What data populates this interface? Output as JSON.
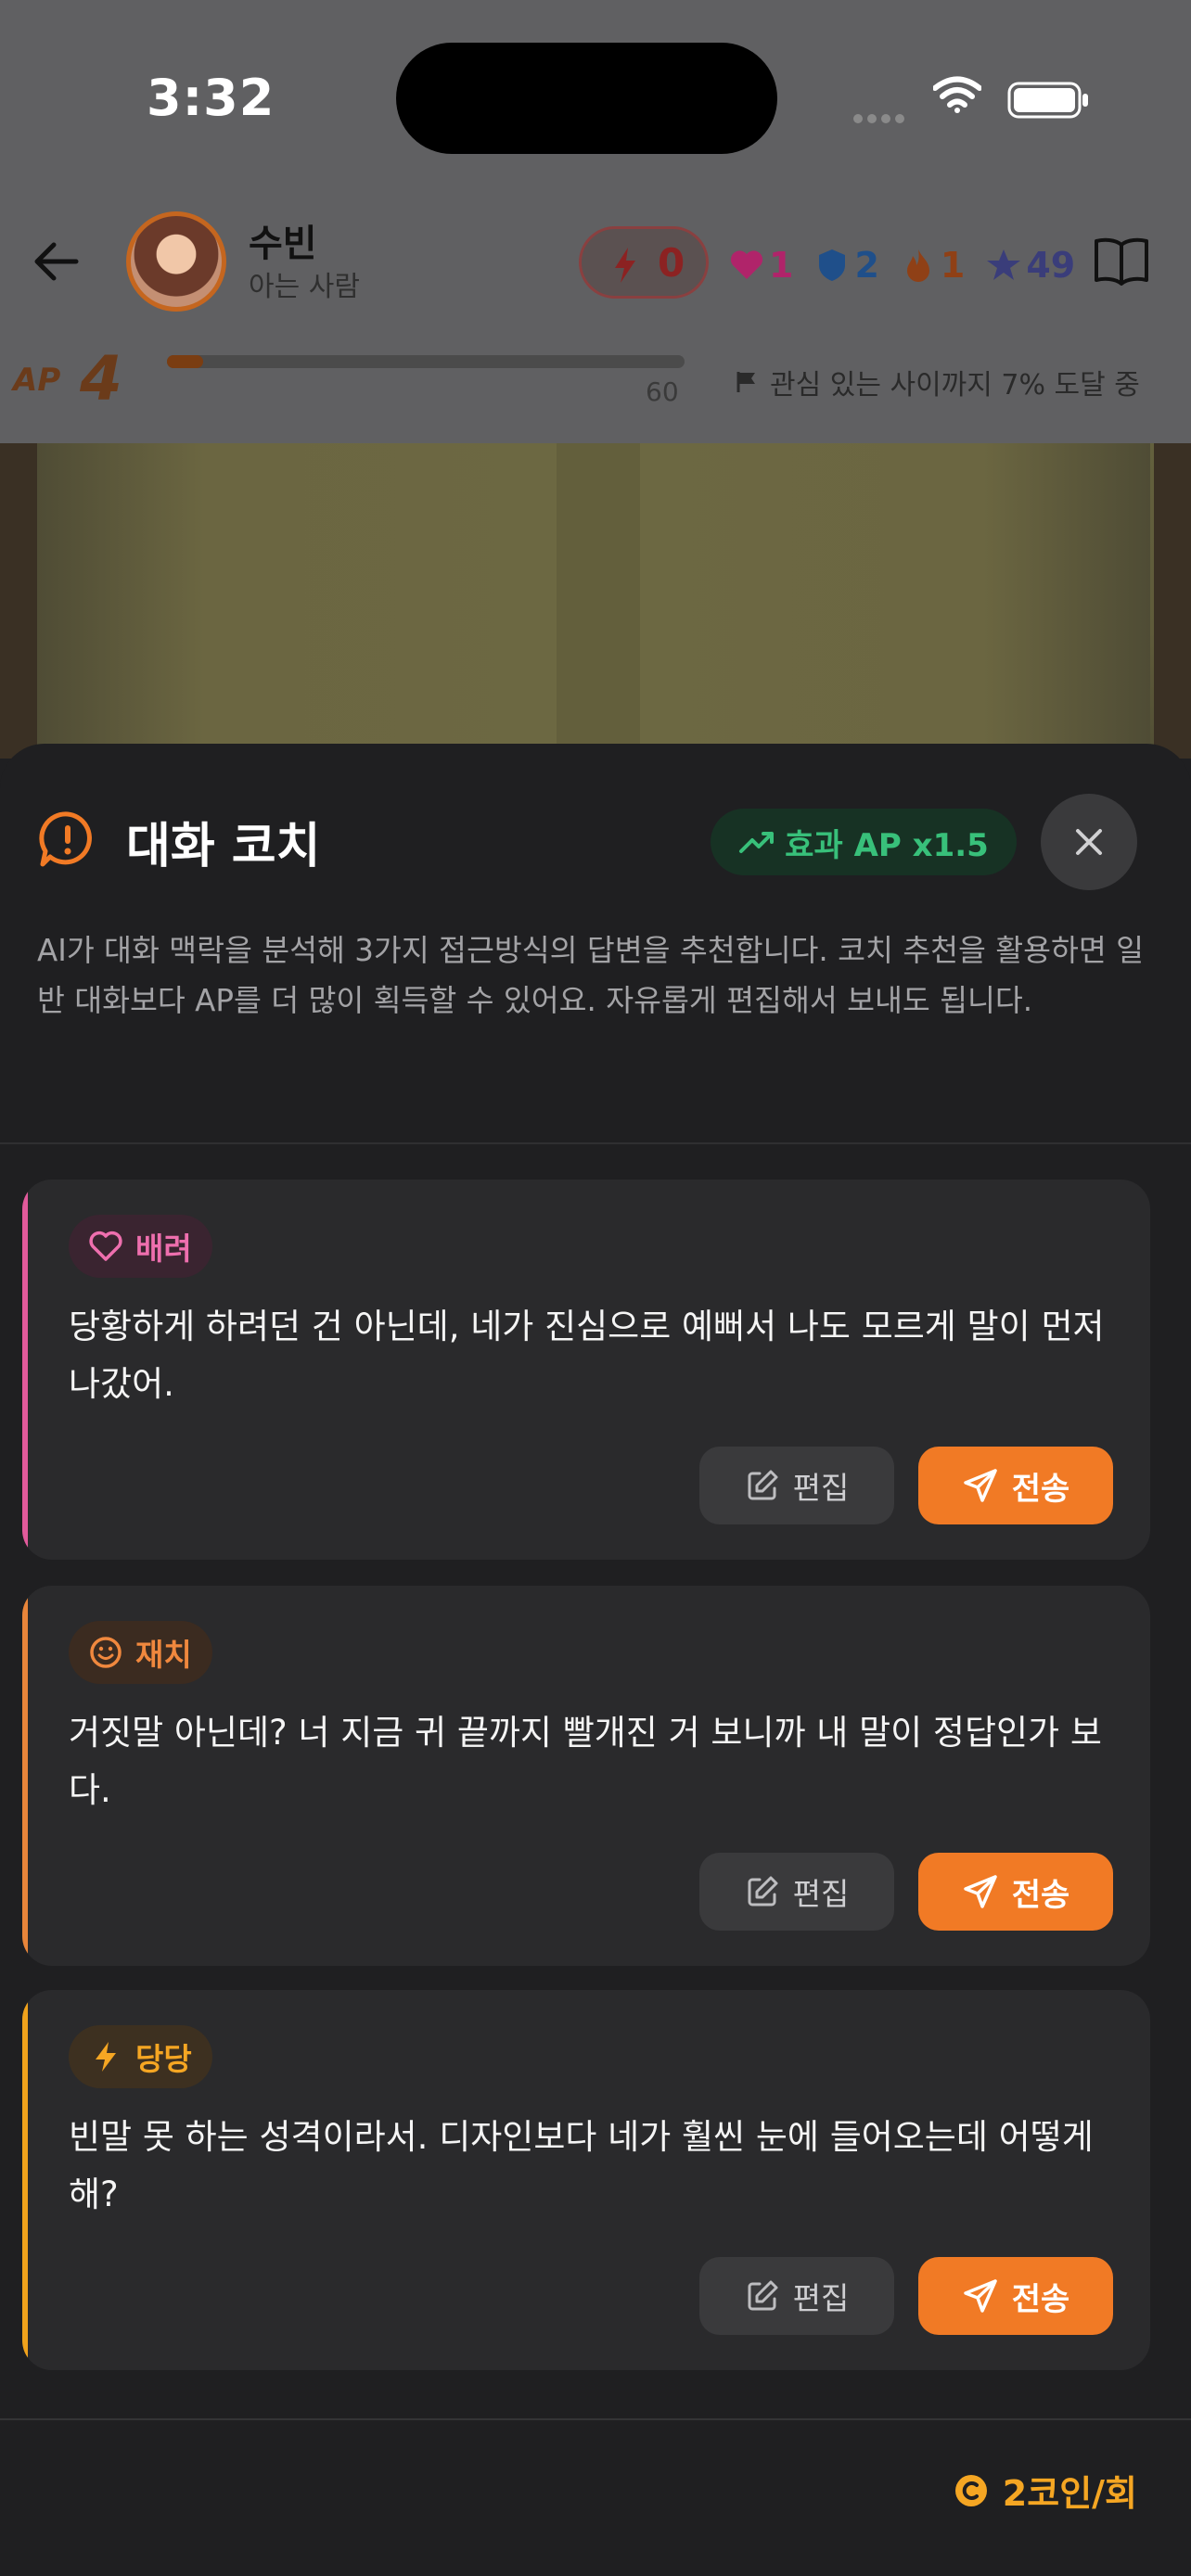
{
  "status_bar": {
    "time": "3:32"
  },
  "header": {
    "name": "수빈",
    "relation": "아는 사람",
    "energy": "0",
    "stats": [
      {
        "icon": "heart-icon",
        "value": "1",
        "color": "#b0246a"
      },
      {
        "icon": "shield-icon",
        "value": "2",
        "color": "#1f4f8a"
      },
      {
        "icon": "flame-icon",
        "value": "1",
        "color": "#8f4016"
      },
      {
        "icon": "star-icon",
        "value": "49",
        "color": "#3a3d7a"
      }
    ]
  },
  "ap": {
    "label": "AP",
    "level": "4",
    "max": "60",
    "progress_percent": 7,
    "goal_text": "관심 있는 사이까지 7% 도달 중"
  },
  "sheet": {
    "title": "대화 코치",
    "effect_badge": "효과 AP x1.5",
    "description": "AI가 대화 맥락을 분석해 3가지 접근방식의 답변을 추천합니다. 코치 추천을 활용하면 일반 대화보다 AP를 더 많이 획득할 수 있어요. 자유롭게 편집해서 보내도 됩니다.",
    "cards": [
      {
        "tag": "배려",
        "tag_icon": "heart-outline-icon",
        "accent": "#e15a9b",
        "tag_bg": "#3a2430",
        "tag_color": "#ee6fae",
        "message": "당황하게 하려던 건 아닌데, 네가 진심으로 예뻐서 나도 모르게 말이 먼저 나갔어.",
        "edit_label": "편집",
        "send_label": "전송"
      },
      {
        "tag": "재치",
        "tag_icon": "smile-icon",
        "accent": "#e8853a",
        "tag_bg": "#3b2b20",
        "tag_color": "#f0883e",
        "message": "거짓말 아닌데? 너 지금 귀 끝까지 빨개진 거 보니까 내 말이 정답인가 보다.",
        "edit_label": "편집",
        "send_label": "전송"
      },
      {
        "tag": "당당",
        "tag_icon": "lightning-icon",
        "accent": "#f0a21c",
        "tag_bg": "#3d3020",
        "tag_color": "#f5a623",
        "message": "빈말 못 하는 성격이라서. 디자인보다 네가 훨씬 눈에 들어오는데 어떻게 해?",
        "edit_label": "편집",
        "send_label": "전송"
      }
    ],
    "cost": "2코인/회"
  }
}
